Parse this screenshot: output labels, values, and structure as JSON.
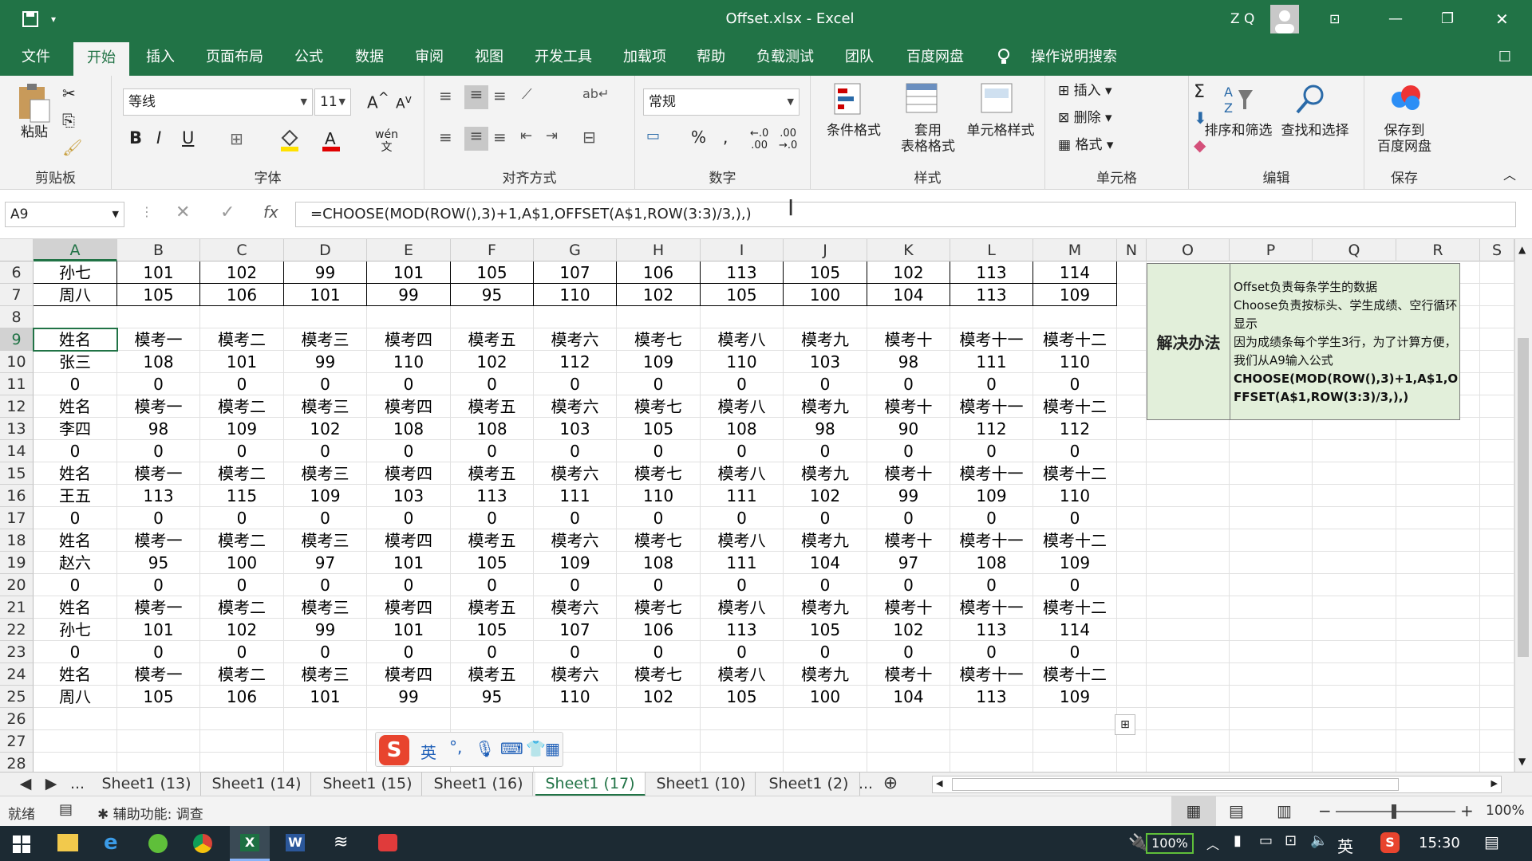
{
  "title": {
    "file": "Offset.xlsx  -  Excel",
    "user": "Z Q"
  },
  "menu": [
    "文件",
    "开始",
    "插入",
    "页面布局",
    "公式",
    "数据",
    "审阅",
    "视图",
    "开发工具",
    "加载项",
    "帮助",
    "负载测试",
    "团队",
    "百度网盘"
  ],
  "menu_active": "开始",
  "tell_me": "操作说明搜索",
  "ribbon": {
    "clipboard": {
      "label": "剪贴板",
      "paste": "粘贴"
    },
    "font": {
      "label": "字体",
      "name": "等线",
      "size": "11",
      "phonetic": "wén"
    },
    "align": {
      "label": "对齐方式"
    },
    "number": {
      "label": "数字",
      "format": "常规"
    },
    "styles": {
      "label": "样式",
      "cond": "条件格式",
      "table1": "套用",
      "table2": "表格格式",
      "cell": "单元格样式"
    },
    "cells": {
      "label": "单元格",
      "insert": "插入",
      "delete": "删除",
      "format": "格式"
    },
    "edit": {
      "label": "编辑",
      "sort": "排序和筛选",
      "find": "查找和选择"
    },
    "save": {
      "label": "保存",
      "save1": "保存到",
      "save2": "百度网盘"
    }
  },
  "namebox": "A9",
  "formula": "=CHOOSE(MOD(ROW(),3)+1,A$1,OFFSET(A$1,ROW(3:3)/3,),)",
  "columns": [
    "A",
    "B",
    "C",
    "D",
    "E",
    "F",
    "G",
    "H",
    "I",
    "J",
    "K",
    "L",
    "M",
    "N",
    "O",
    "P",
    "Q",
    "R",
    "S"
  ],
  "rows": [
    {
      "n": "6",
      "cells": [
        "孙七",
        "101",
        "102",
        "99",
        "101",
        "105",
        "107",
        "106",
        "113",
        "105",
        "102",
        "113",
        "114"
      ]
    },
    {
      "n": "7",
      "cells": [
        "周八",
        "105",
        "106",
        "101",
        "99",
        "95",
        "110",
        "102",
        "105",
        "100",
        "104",
        "113",
        "109"
      ]
    },
    {
      "n": "8",
      "cells": []
    },
    {
      "n": "9",
      "cells": [
        "姓名",
        "模考一",
        "模考二",
        "模考三",
        "模考四",
        "模考五",
        "模考六",
        "模考七",
        "模考八",
        "模考九",
        "模考十",
        "模考十一",
        "模考十二"
      ]
    },
    {
      "n": "10",
      "cells": [
        "张三",
        "108",
        "101",
        "99",
        "110",
        "102",
        "112",
        "109",
        "110",
        "103",
        "98",
        "111",
        "110"
      ]
    },
    {
      "n": "11",
      "cells": [
        "0",
        "0",
        "0",
        "0",
        "0",
        "0",
        "0",
        "0",
        "0",
        "0",
        "0",
        "0",
        "0"
      ]
    },
    {
      "n": "12",
      "cells": [
        "姓名",
        "模考一",
        "模考二",
        "模考三",
        "模考四",
        "模考五",
        "模考六",
        "模考七",
        "模考八",
        "模考九",
        "模考十",
        "模考十一",
        "模考十二"
      ]
    },
    {
      "n": "13",
      "cells": [
        "李四",
        "98",
        "109",
        "102",
        "108",
        "108",
        "103",
        "105",
        "108",
        "98",
        "90",
        "112",
        "112"
      ]
    },
    {
      "n": "14",
      "cells": [
        "0",
        "0",
        "0",
        "0",
        "0",
        "0",
        "0",
        "0",
        "0",
        "0",
        "0",
        "0",
        "0"
      ]
    },
    {
      "n": "15",
      "cells": [
        "姓名",
        "模考一",
        "模考二",
        "模考三",
        "模考四",
        "模考五",
        "模考六",
        "模考七",
        "模考八",
        "模考九",
        "模考十",
        "模考十一",
        "模考十二"
      ]
    },
    {
      "n": "16",
      "cells": [
        "王五",
        "113",
        "115",
        "109",
        "103",
        "113",
        "111",
        "110",
        "111",
        "102",
        "99",
        "109",
        "110"
      ]
    },
    {
      "n": "17",
      "cells": [
        "0",
        "0",
        "0",
        "0",
        "0",
        "0",
        "0",
        "0",
        "0",
        "0",
        "0",
        "0",
        "0"
      ]
    },
    {
      "n": "18",
      "cells": [
        "姓名",
        "模考一",
        "模考二",
        "模考三",
        "模考四",
        "模考五",
        "模考六",
        "模考七",
        "模考八",
        "模考九",
        "模考十",
        "模考十一",
        "模考十二"
      ]
    },
    {
      "n": "19",
      "cells": [
        "赵六",
        "95",
        "100",
        "97",
        "101",
        "105",
        "109",
        "108",
        "111",
        "104",
        "97",
        "108",
        "109"
      ]
    },
    {
      "n": "20",
      "cells": [
        "0",
        "0",
        "0",
        "0",
        "0",
        "0",
        "0",
        "0",
        "0",
        "0",
        "0",
        "0",
        "0"
      ]
    },
    {
      "n": "21",
      "cells": [
        "姓名",
        "模考一",
        "模考二",
        "模考三",
        "模考四",
        "模考五",
        "模考六",
        "模考七",
        "模考八",
        "模考九",
        "模考十",
        "模考十一",
        "模考十二"
      ]
    },
    {
      "n": "22",
      "cells": [
        "孙七",
        "101",
        "102",
        "99",
        "101",
        "105",
        "107",
        "106",
        "113",
        "105",
        "102",
        "113",
        "114"
      ]
    },
    {
      "n": "23",
      "cells": [
        "0",
        "0",
        "0",
        "0",
        "0",
        "0",
        "0",
        "0",
        "0",
        "0",
        "0",
        "0",
        "0"
      ]
    },
    {
      "n": "24",
      "cells": [
        "姓名",
        "模考一",
        "模考二",
        "模考三",
        "模考四",
        "模考五",
        "模考六",
        "模考七",
        "模考八",
        "模考九",
        "模考十",
        "模考十一",
        "模考十二"
      ]
    },
    {
      "n": "25",
      "cells": [
        "周八",
        "105",
        "106",
        "101",
        "99",
        "95",
        "110",
        "102",
        "105",
        "100",
        "104",
        "113",
        "109"
      ]
    },
    {
      "n": "26",
      "cells": []
    },
    {
      "n": "27",
      "cells": []
    },
    {
      "n": "28",
      "cells": []
    }
  ],
  "note": {
    "head": "解决办法",
    "line1": "Offset负责每条学生的数据",
    "line2": "Choose负责按标头、学生成绩、空行循环显示",
    "line3": "因为成绩条每个学生3行，为了计算方便，我们从A9输入公式",
    "line4": "CHOOSE(MOD(ROW(),3)+1,A$1,OFFSET(A$1,ROW(3:3)/3,),)"
  },
  "sheets": [
    "Sheet1 (13)",
    "Sheet1 (14)",
    "Sheet1 (15)",
    "Sheet1 (16)",
    "Sheet1 (17)",
    "Sheet1 (10)",
    "Sheet1 (2)"
  ],
  "sheet_active": "Sheet1 (17)",
  "more": "...",
  "status": {
    "ready": "就绪",
    "access": "辅助功能: 调查",
    "zoom": "100%"
  },
  "ime": {
    "lang": "英"
  },
  "taskbar": {
    "battery": "100%",
    "lang": "英",
    "time": "15:30"
  },
  "colors": {
    "excel_green": "#217346",
    "note_fill": "#e2efda"
  }
}
